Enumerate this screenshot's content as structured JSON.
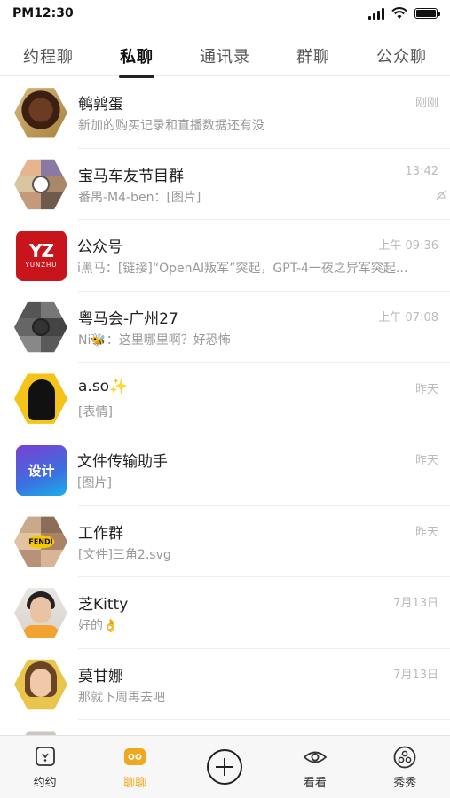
{
  "status_bar": {
    "time": "PM12:30"
  },
  "tabs": [
    {
      "label": "约程聊",
      "active": false
    },
    {
      "label": "私聊",
      "active": true
    },
    {
      "label": "通讯录",
      "active": false
    },
    {
      "label": "群聊",
      "active": false
    },
    {
      "label": "公众聊",
      "active": false
    }
  ],
  "chats": [
    {
      "name": "鹌鹑蛋",
      "message": "新加的购买记录和直播数据还有没",
      "time": "刚刚",
      "avatar": "photo-avatar"
    },
    {
      "name": "宝马车友节目群",
      "message": "番禺-M4-ben：[图片]",
      "time": "13:42",
      "muted": true,
      "avatar": "group-avatar"
    },
    {
      "name": "公众号",
      "message": "i黑马：[链接]“OpenAI叛军”突起，GPT-4一夜之异军突起...",
      "time": "上午 09:36",
      "avatar": "yunzhu-logo-avatar",
      "avatar_text": "YZ",
      "avatar_sub": "YUNZHU"
    },
    {
      "name": "粤马会-广州27",
      "message": "Ni🐝：这里哪里啊？好恐怖",
      "time": "上午 07:08",
      "avatar": "group-avatar"
    },
    {
      "name": "a.so✨",
      "message": "[表情]",
      "time": "昨天",
      "avatar": "silhouette-avatar"
    },
    {
      "name": "文件传输助手",
      "message": "[图片]",
      "time": "昨天",
      "avatar": "design-avatar",
      "avatar_text": "设计"
    },
    {
      "name": "工作群",
      "message": "[文件]三角2.svg",
      "time": "昨天",
      "avatar": "group-avatar",
      "avatar_text": "FENDI"
    },
    {
      "name": "芝Kitty",
      "message": "好的👌",
      "time": "7月13日",
      "avatar": "photo-avatar"
    },
    {
      "name": "莫甘娜",
      "message": "那就下周再去吧",
      "time": "7月13日",
      "avatar": "photo-avatar"
    },
    {
      "name": "",
      "message": "",
      "time": "",
      "avatar": "photo-avatar"
    }
  ],
  "bottom_nav": [
    {
      "label": "约约",
      "icon": "yueyue-icon",
      "active": false
    },
    {
      "label": "聊聊",
      "icon": "chat-icon",
      "active": true
    },
    {
      "label": "",
      "icon": "plus-icon",
      "active": false
    },
    {
      "label": "看看",
      "icon": "eye-icon",
      "active": false
    },
    {
      "label": "秀秀",
      "icon": "show-icon",
      "active": false
    }
  ],
  "colors": {
    "accent": "#f0a91f",
    "text": "#222222",
    "muted": "#999999"
  }
}
